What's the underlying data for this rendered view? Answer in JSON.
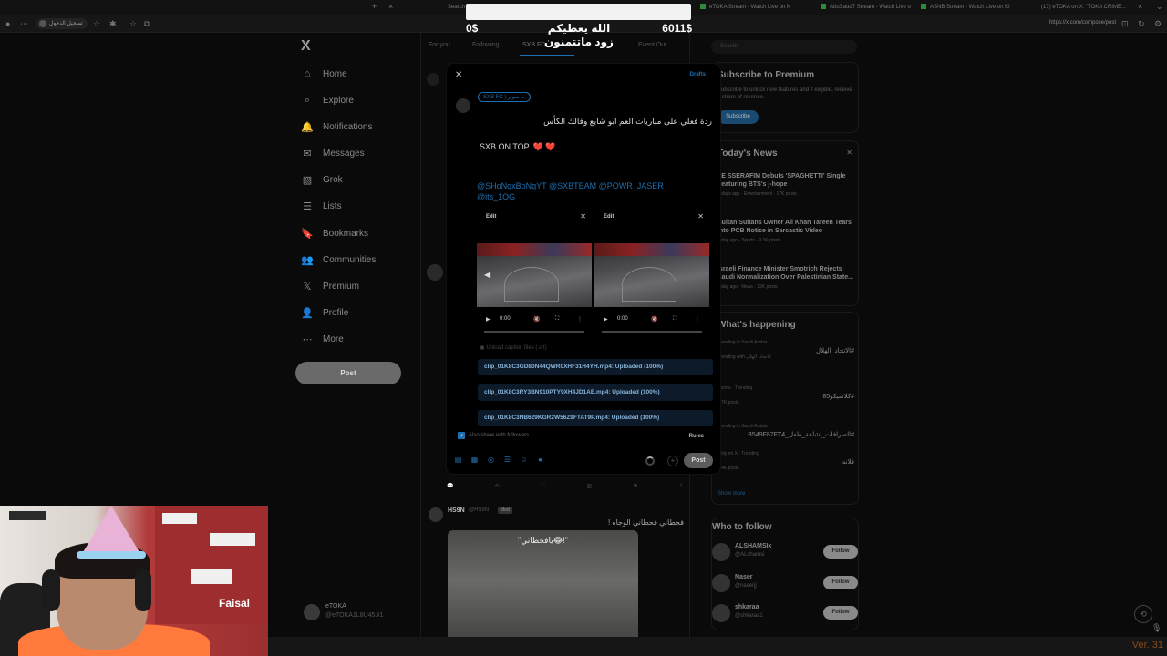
{
  "browser": {
    "tabs": [
      "Search",
      "eTOKA Stream - Watch Live on K",
      "AbuSaud7 Stream - Watch Live o",
      "ASNB Stream - Watch Live on Ki",
      "(17) eTOKA on X: \"TOKA CRIME..."
    ],
    "url": "https://x.com/compose/post",
    "profile_label": "تسجيل الدخول"
  },
  "donation": {
    "current": "0$",
    "goal": "6011$",
    "progress": 0,
    "message_line1": "الله يعطيكم",
    "message_line2": "زود ماتتمنون"
  },
  "nav": {
    "logo": "X",
    "items": [
      {
        "label": "Home",
        "icon": "home-icon"
      },
      {
        "label": "Explore",
        "icon": "search-icon"
      },
      {
        "label": "Notifications",
        "icon": "bell-icon"
      },
      {
        "label": "Messages",
        "icon": "mail-icon"
      },
      {
        "label": "Grok",
        "icon": "grok-icon"
      },
      {
        "label": "Lists",
        "icon": "list-icon"
      },
      {
        "label": "Bookmarks",
        "icon": "bookmark-icon"
      },
      {
        "label": "Communities",
        "icon": "people-icon"
      },
      {
        "label": "Premium",
        "icon": "x-icon"
      },
      {
        "label": "Profile",
        "icon": "user-icon"
      },
      {
        "label": "More",
        "icon": "more-icon"
      }
    ],
    "post_label": "Post",
    "account": {
      "name": "eTOKA",
      "handle": "@eTOKA1L8U45Ji1",
      "more": "···"
    }
  },
  "main": {
    "tabs": [
      "For you",
      "Following",
      "SXB FC",
      "Event Out"
    ],
    "tweet": {
      "name": "HS9N",
      "handle": "@HS9N",
      "badge": "Mod",
      "text": "فحطاني فحطاني الوجاه !",
      "caption": "\"يافحطاني😂!\""
    }
  },
  "compose": {
    "close": "✕",
    "drafts": "Drafts",
    "community": "SXB FC | سوبر",
    "text_ar": "ردة فعلي على مباريات العم ابو شايع وفالك الكأس",
    "text_en": "SXB ON TOP",
    "hearts": "❤️ ❤️",
    "mentions": "@SHoNgxBoNgYT @SXBTEAM  @POWR_JASER_ @its_1OG",
    "media": [
      {
        "edit": "Edit",
        "time": "0:00"
      },
      {
        "edit": "Edit",
        "time": "0:00"
      }
    ],
    "captions_label": "Upload caption files (.srt)",
    "uploads": [
      "clip_01K8C3GD80N44QWR0XHF31H4YH.mp4: Uploaded (100%)",
      "clip_01K8C3RY3BN910PTY9XH4JD1AE.mp4: Uploaded (100%)",
      "clip_01K8C3NB629KGR2W56Z9FTAT9P.mp4: Uploaded (100%)"
    ],
    "also_share": "Also share with followers",
    "rules": "Rules",
    "post_label": "Post"
  },
  "sidebar": {
    "search_placeholder": "Search",
    "premium": {
      "title": "Subscribe to Premium",
      "desc": "Subscribe to unlock new features and if eligible, receive a share of revenue.",
      "button": "Subscribe"
    },
    "news": {
      "title": "Today's News",
      "items": [
        {
          "title": "LE SSERAFIM Debuts 'SPAGHETTI' Single Featuring BTS's j-hope",
          "meta": "2 days ago · Entertainment · 17K posts"
        },
        {
          "title": "Sultan Sultans Owner Ali Khan Tareen Tears Into PCB Notice in Sarcastic Video",
          "meta": "1 day ago · Sports · 9.1K posts"
        },
        {
          "title": "Israeli Finance Minister Smotrich Rejects Saudi Normalization Over Palestinian State...",
          "meta": "1 day ago · News · 12K posts"
        }
      ]
    },
    "happening": {
      "title": "What's happening",
      "items": [
        {
          "context": "Trending in Saudi Arabia",
          "name": "#الاتحاد_الهلال",
          "posts": "Trending with الاتحاد، الهلال"
        },
        {
          "context": "Sports · Trending",
          "name": "#كلاسيكو85",
          "posts": "1.7K posts"
        },
        {
          "context": "Trending in Saudi Arabia",
          "name": "#الصرافات_اشاعة_طفل_B549F87FT4",
          "posts": ""
        },
        {
          "context": "Only on X · Trending",
          "name": "فلانه",
          "posts": "1.4K posts"
        }
      ],
      "show_more": "Show more"
    },
    "who_to_follow": {
      "title": "Who to follow",
      "items": [
        {
          "name": "ALSHAMSIx",
          "handle": "@ALshamsi",
          "button": "Follow"
        },
        {
          "name": "Naser",
          "handle": "@naserjj",
          "button": "Follow"
        },
        {
          "name": "shkaraa",
          "handle": "@shkaraa1",
          "button": "Follow"
        }
      ]
    }
  },
  "overlay": {
    "version": "Ver. 31"
  }
}
